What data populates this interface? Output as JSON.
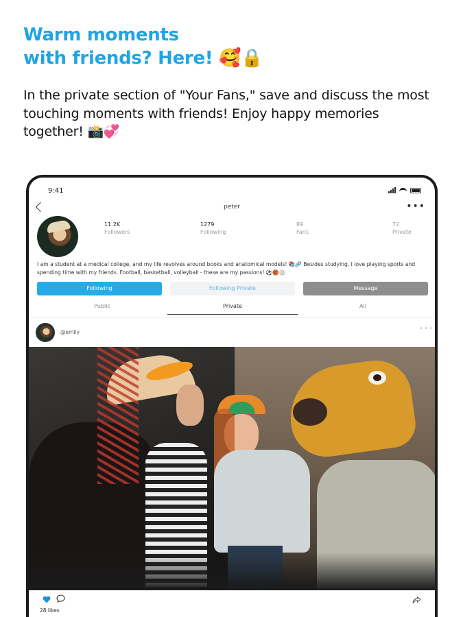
{
  "headline": {
    "line1": "Warm moments",
    "line2": "with friends? Here! 🥰🔒"
  },
  "subtext": "In the private section of  \"Your Fans,\" save and discuss the most touching moments with friends! Enjoy happy memories together! 📸💞",
  "phone": {
    "status_time": "9:41",
    "username": "peter",
    "stats": [
      {
        "value": "11.2K",
        "label": "Followers"
      },
      {
        "value": "1279",
        "label": "Following"
      },
      {
        "value": "89",
        "label": "Fans"
      },
      {
        "value": "72",
        "label": "Private"
      }
    ],
    "bio": "I am a student at a medical college, and my life revolves around books and anatomical models! 📚🧬 Besides studying, I love playing sports and spending time with my friends. Football, basketball, volleyball - these are my passions! ⚽🏀🏐",
    "buttons": {
      "following": "Following",
      "following_private": "Following Private",
      "message": "Message"
    },
    "tabs": [
      "Public",
      "Private",
      "All"
    ],
    "active_tab": "Private",
    "post": {
      "user": "@emily",
      "likes": "28 likes"
    },
    "icons": {
      "back": "back-chevron-icon",
      "more": "more-icon",
      "heart": "heart-icon",
      "comment": "comment-icon",
      "share": "share-icon"
    }
  },
  "colors": {
    "accent": "#20a5e3",
    "following_button": "#25ace8",
    "message_button": "#8e8e8e",
    "heart": "#1f8fe0"
  }
}
